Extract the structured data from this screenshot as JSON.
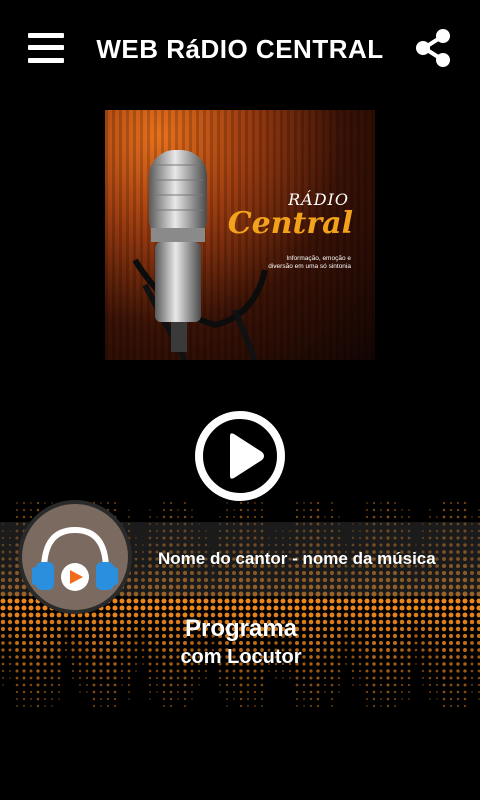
{
  "header": {
    "title": "WEB RáDIO CENTRAL",
    "menu_icon": "hamburger-menu-icon",
    "share_icon": "share-icon"
  },
  "cover": {
    "brand_top": "RÁDIO",
    "brand_main": "Central",
    "tagline": "Informação, emoção e diversão em uma só sintonia",
    "accent": "#f2a31b"
  },
  "player": {
    "play_icon": "play-icon",
    "now_playing": "Nome do cantor - nome da música",
    "program_title": "Programa",
    "program_host": "com Locutor",
    "avatar_icon": "headphones-play-icon"
  },
  "colors": {
    "background": "#000000",
    "equalizer": "#f28a1e"
  }
}
